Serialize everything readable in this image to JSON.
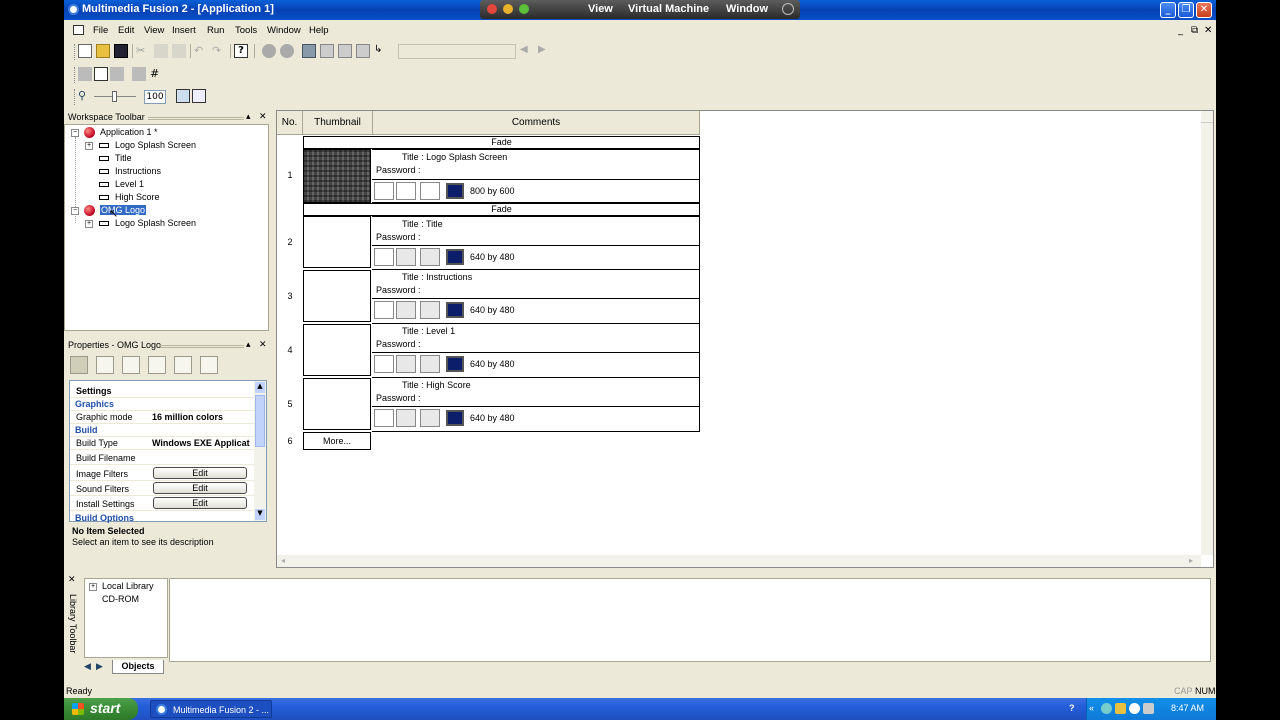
{
  "window": {
    "title": "Multimedia Fusion 2 - [Application 1]"
  },
  "vm_bar": {
    "items": [
      "View",
      "Virtual Machine",
      "Window"
    ]
  },
  "menu": {
    "items": [
      "File",
      "Edit",
      "View",
      "Insert",
      "Run",
      "Tools",
      "Window",
      "Help"
    ]
  },
  "zoom": {
    "value": "100"
  },
  "workspace": {
    "title": "Workspace Toolbar",
    "tree": [
      {
        "label": "Application 1 *",
        "type": "app"
      },
      {
        "label": "Logo Splash Screen",
        "type": "frame-expand"
      },
      {
        "label": "Title",
        "type": "frame"
      },
      {
        "label": "Instructions",
        "type": "frame"
      },
      {
        "label": "Level 1",
        "type": "frame"
      },
      {
        "label": "High Score",
        "type": "frame"
      },
      {
        "label": "OMG Logo",
        "type": "app-selected"
      },
      {
        "label": "Logo Splash Screen",
        "type": "frame-expand"
      }
    ]
  },
  "properties": {
    "title": "Properties - OMG Logo",
    "rows": [
      {
        "name": "Settings",
        "kind": "heading"
      },
      {
        "name": "Graphics",
        "kind": "section"
      },
      {
        "name": "Graphic mode",
        "value": "16 million colors"
      },
      {
        "name": "Build",
        "kind": "section"
      },
      {
        "name": "Build Type",
        "value": "Windows EXE Applicat"
      },
      {
        "name": "Build Filename",
        "value": ""
      },
      {
        "name": "Image Filters",
        "button": "Edit"
      },
      {
        "name": "Sound Filters",
        "button": "Edit"
      },
      {
        "name": "Install Settings",
        "button": "Edit"
      },
      {
        "name": "Build Options",
        "kind": "section"
      }
    ],
    "desc_title": "No Item Selected",
    "desc_text": "Select an item to see its description"
  },
  "storyboard": {
    "headers": {
      "no": "No.",
      "thumbnail": "Thumbnail",
      "comments": "Comments"
    },
    "frames": [
      {
        "num": "1",
        "transition": "Fade",
        "title": "Title : Logo Splash Screen",
        "password": "Password :",
        "size": "800  by  600",
        "thumb": "image"
      },
      {
        "num": "2",
        "transition": "Fade",
        "title": "Title : Title",
        "password": "Password :",
        "size": "640  by  480",
        "thumb": "blank"
      },
      {
        "num": "3",
        "transition": "",
        "title": "Title : Instructions",
        "password": "Password :",
        "size": "640  by  480",
        "thumb": "blank"
      },
      {
        "num": "4",
        "transition": "",
        "title": "Title : Level 1",
        "password": "Password :",
        "size": "640  by  480",
        "thumb": "blank"
      },
      {
        "num": "5",
        "transition": "",
        "title": "Title : High Score",
        "password": "Password :",
        "size": "640  by  480",
        "thumb": "blank"
      }
    ],
    "more": {
      "num": "6",
      "label": "More..."
    }
  },
  "library": {
    "toolbar_label": "Library Toolbar",
    "tree": [
      "Local Library",
      "CD-ROM"
    ],
    "tab": "Objects"
  },
  "status": {
    "left": "Ready",
    "cap": "CAP",
    "num": "NUM"
  },
  "taskbar": {
    "start": "start",
    "task": "Multimedia Fusion 2 - ...",
    "clock": "8:47 AM"
  }
}
